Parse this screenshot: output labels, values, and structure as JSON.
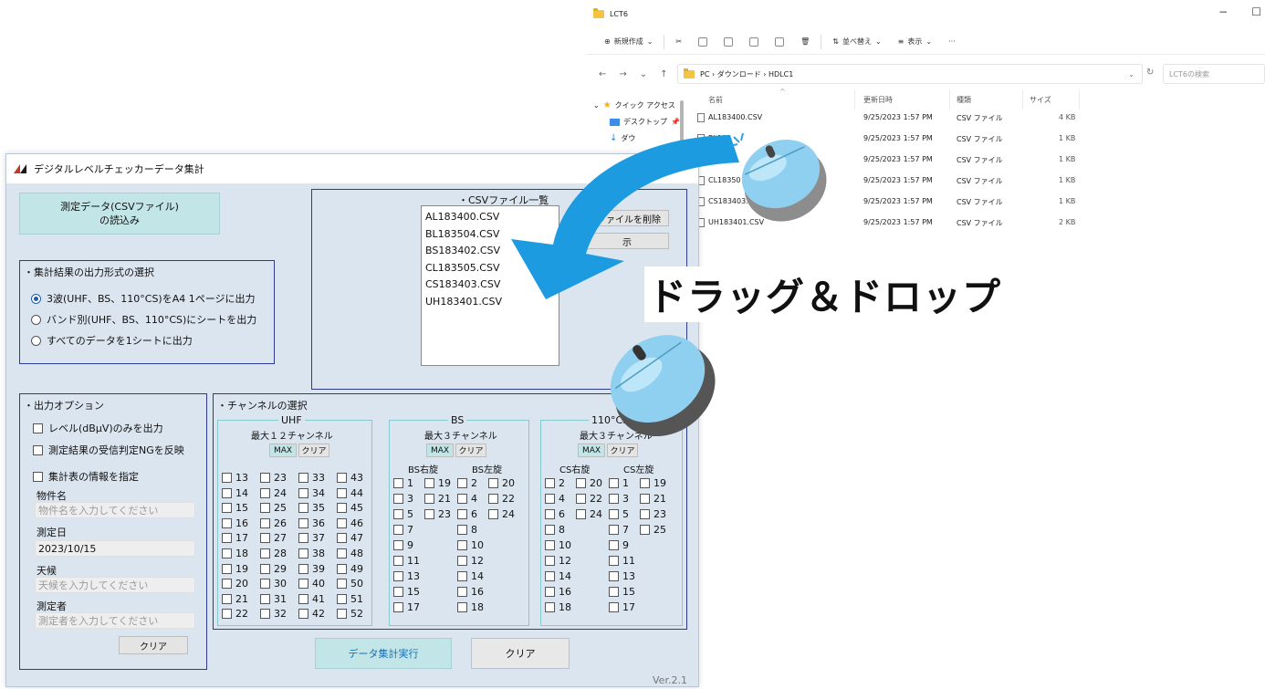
{
  "explorer": {
    "title": "LCT6",
    "toolbar": {
      "new": "新規作成",
      "sort": "並べ替え",
      "view": "表示",
      "more": "···"
    },
    "address": {
      "path": "PC › ダウンロード › HDLC1",
      "search_placeholder": "LCT6の検索"
    },
    "nav": {
      "quick_access": "クイック アクセス",
      "desktop": "デスクトップ",
      "downloads": "ダウ"
    },
    "columns": {
      "name": "名前",
      "date": "更新日時",
      "type": "種類",
      "size": "サイズ"
    },
    "files": [
      {
        "name": "AL183400.CSV",
        "date": "9/25/2023 1:57 PM",
        "type": "CSV ファイル",
        "size": "4 KB"
      },
      {
        "name": "BL183",
        "date": "9/25/2023 1:57 PM",
        "type": "CSV ファイル",
        "size": "1 KB"
      },
      {
        "name": "BS18.",
        "date": "9/25/2023 1:57 PM",
        "type": "CSV ファイル",
        "size": "1 KB"
      },
      {
        "name": "CL18350",
        "date": "9/25/2023 1:57 PM",
        "type": "CSV ファイル",
        "size": "1 KB"
      },
      {
        "name": "CS183403.CSV",
        "date": "9/25/2023 1:57 PM",
        "type": "CSV ファイル",
        "size": "1 KB"
      },
      {
        "name": "UH183401.CSV",
        "date": "9/25/2023 1:57 PM",
        "type": "CSV ファイル",
        "size": "2 KB"
      }
    ]
  },
  "app": {
    "title": "デジタルレベルチェッカーデータ集計",
    "load_button_line1": "測定データ(CSVファイル)",
    "load_button_line2": "の読込み",
    "csv_title": "・CSVファイル一覧",
    "csv_files": [
      "AL183400.CSV",
      "BL183504.CSV",
      "BS183402.CSV",
      "CL183505.CSV",
      "CS183403.CSV",
      "UH183401.CSV"
    ],
    "delete_button": "択ファイルを削除",
    "partial_button": "示",
    "output_format": {
      "title": "・集計結果の出力形式の選択",
      "options": [
        "3波(UHF、BS、110°CS)をA4 1ページに出力",
        "バンド別(UHF、BS、110°CS)にシートを出力",
        "すべてのデータを1シートに出力"
      ]
    },
    "output_options": {
      "title": "・出力オプション",
      "level_only": "レベル(dBμV)のみを出力",
      "reflect_ng": "測定結果の受信判定NGを反映",
      "table_info": "集計表の情報を指定",
      "property_label": "物件名",
      "property_placeholder": "物件名を入力してください",
      "date_label": "測定日",
      "date_value": "2023/10/15",
      "weather_label": "天候",
      "weather_placeholder": "天候を入力してください",
      "person_label": "測定者",
      "person_placeholder": "測定者を入力してください",
      "clear": "クリア"
    },
    "channels": {
      "title": "・チャンネルの選択",
      "max": "MAX",
      "clear": "クリア",
      "uhf": {
        "title": "UHF",
        "caption": "最大１２チャンネル",
        "cols": [
          [
            "13",
            "14",
            "15",
            "16",
            "17",
            "18",
            "19",
            "20",
            "21",
            "22"
          ],
          [
            "23",
            "24",
            "25",
            "26",
            "27",
            "28",
            "29",
            "30",
            "31",
            "32"
          ],
          [
            "33",
            "34",
            "35",
            "36",
            "37",
            "38",
            "39",
            "40",
            "41",
            "42"
          ],
          [
            "43",
            "44",
            "45",
            "46",
            "47",
            "48",
            "49",
            "50",
            "51",
            "52"
          ]
        ]
      },
      "bs": {
        "title": "BS",
        "caption": "最大３チャンネル",
        "right_label": "BS右旋",
        "left_label": "BS左旋",
        "cols": [
          [
            "1",
            "3",
            "5",
            "7",
            "9",
            "11",
            "13",
            "15",
            "17"
          ],
          [
            "19",
            "21",
            "23"
          ],
          [
            "2",
            "4",
            "6",
            "8",
            "10",
            "12",
            "14",
            "16",
            "18"
          ],
          [
            "20",
            "22",
            "24"
          ]
        ]
      },
      "cs": {
        "title": "110°CS",
        "caption": "最大３チャンネル",
        "right_label": "CS右旋",
        "left_label": "CS左旋",
        "cols": [
          [
            "2",
            "4",
            "6",
            "8",
            "10",
            "12",
            "14",
            "16",
            "18"
          ],
          [
            "20",
            "22",
            "24"
          ],
          [
            "1",
            "3",
            "5",
            "7",
            "9",
            "11",
            "13",
            "15",
            "17"
          ],
          [
            "19",
            "21",
            "23",
            "25"
          ]
        ]
      }
    },
    "execute": "データ集計実行",
    "clear_all": "クリア",
    "version": "Ver.2.1"
  },
  "overlay": {
    "label": "ドラッグ＆ドロップ",
    "arrow_color": "#1d9be0",
    "mouse_color": "#8fd0f0"
  }
}
